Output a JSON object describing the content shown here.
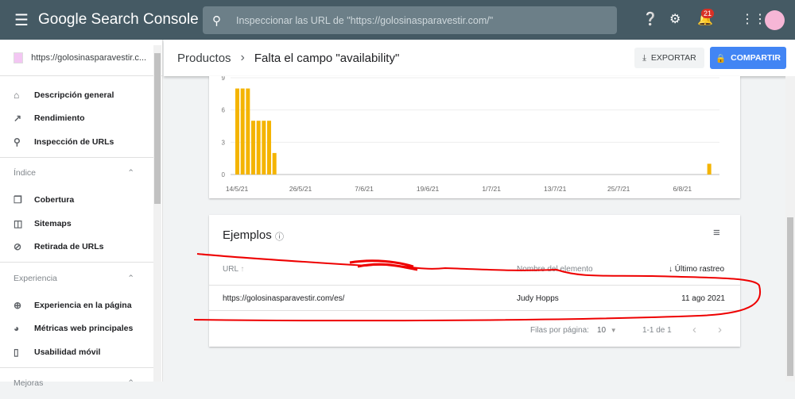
{
  "header": {
    "app_title": "Google Search Console",
    "search_placeholder": "Inspeccionar las URL de \"https://golosinasparavestir.com/\"",
    "notifications": "21"
  },
  "sidebar": {
    "property": "https://golosinasparavestir.c...",
    "items": [
      {
        "label": "Descripción general",
        "icon": "home-icon"
      },
      {
        "label": "Rendimiento",
        "icon": "trending-up-icon"
      },
      {
        "label": "Inspección de URLs",
        "icon": "search-icon"
      }
    ],
    "sections": [
      {
        "title": "Índice",
        "items": [
          {
            "label": "Cobertura",
            "icon": "copy-icon"
          },
          {
            "label": "Sitemaps",
            "icon": "sitemap-icon"
          },
          {
            "label": "Retirada de URLs",
            "icon": "eye-off-icon"
          }
        ]
      },
      {
        "title": "Experiencia",
        "items": [
          {
            "label": "Experiencia en la página",
            "icon": "plus-circle-icon"
          },
          {
            "label": "Métricas web principales",
            "icon": "gauge-icon"
          },
          {
            "label": "Usabilidad móvil",
            "icon": "phone-icon"
          }
        ]
      },
      {
        "title": "Mejoras",
        "items": []
      }
    ]
  },
  "breadcrumb": {
    "parent": "Productos",
    "current": "Falta el campo \"availability\""
  },
  "actions": {
    "export": "EXPORTAR",
    "share": "COMPARTIR"
  },
  "chart_data": {
    "type": "bar",
    "start": "14/5/21",
    "days": 90,
    "nonzero": {
      "0": 8,
      "1": 8,
      "2": 8,
      "3": 5,
      "4": 5,
      "5": 5,
      "6": 5,
      "7": 2,
      "89": 1
    },
    "yticks": [
      "0",
      "3",
      "6",
      "9"
    ],
    "ylim": [
      0,
      9
    ],
    "xticks": [
      "14/5/21",
      "26/5/21",
      "7/6/21",
      "19/6/21",
      "1/7/21",
      "13/7/21",
      "25/7/21",
      "6/8/21"
    ],
    "color": "#f4b400"
  },
  "examples": {
    "title": "Ejemplos",
    "columns": [
      "URL",
      "Nombre del elemento",
      "Último rastreo"
    ],
    "rows": [
      {
        "url": "https://golosinasparavestir.com/es/",
        "name": "Judy Hopps",
        "date": "11 ago 2021"
      }
    ],
    "rows_per_page_label": "Filas por página:",
    "rows_per_page": "10",
    "range": "1-1 de 1"
  }
}
